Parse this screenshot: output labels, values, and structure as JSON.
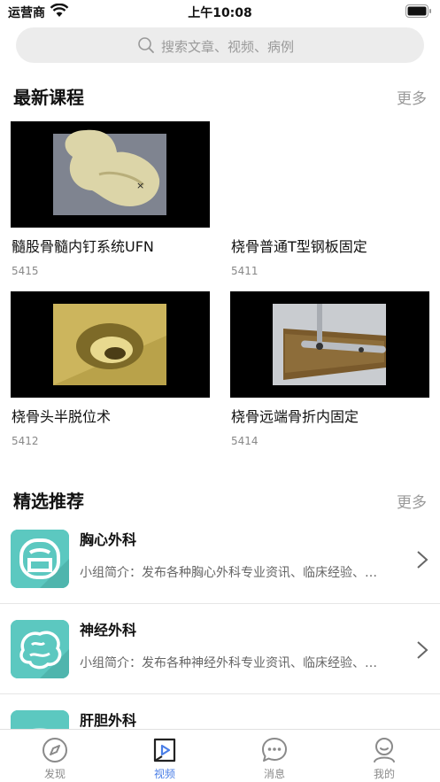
{
  "status_bar": {
    "carrier": "运营商",
    "time": "上午10:08"
  },
  "search": {
    "placeholder": "搜索文章、视频、病例"
  },
  "latest": {
    "title": "最新课程",
    "more": "更多",
    "courses": [
      {
        "title": "髓股骨髓内钉系统UFN",
        "count": "5415"
      },
      {
        "title": "桡骨普通T型钢板固定",
        "count": "5411"
      },
      {
        "title": "桡骨头半脱位术",
        "count": "5412"
      },
      {
        "title": "桡骨远端骨折内固定",
        "count": "5414"
      }
    ]
  },
  "featured": {
    "title": "精选推荐",
    "more": "更多",
    "groups": [
      {
        "name": "胸心外科",
        "desc": "小组简介：发布各种胸心外科专业资讯、临床经验、…"
      },
      {
        "name": "神经外科",
        "desc": "小组简介：发布各种神经外科专业资讯、临床经验、…"
      },
      {
        "name": "肝胆外科",
        "desc": ""
      }
    ]
  },
  "tabs": [
    {
      "label": "发现",
      "icon": "compass-icon"
    },
    {
      "label": "视频",
      "icon": "video-icon"
    },
    {
      "label": "消息",
      "icon": "chat-icon"
    },
    {
      "label": "我的",
      "icon": "user-icon"
    }
  ],
  "colors": {
    "accent": "#4a7ee6",
    "group_icon": "#5cc8c0"
  }
}
